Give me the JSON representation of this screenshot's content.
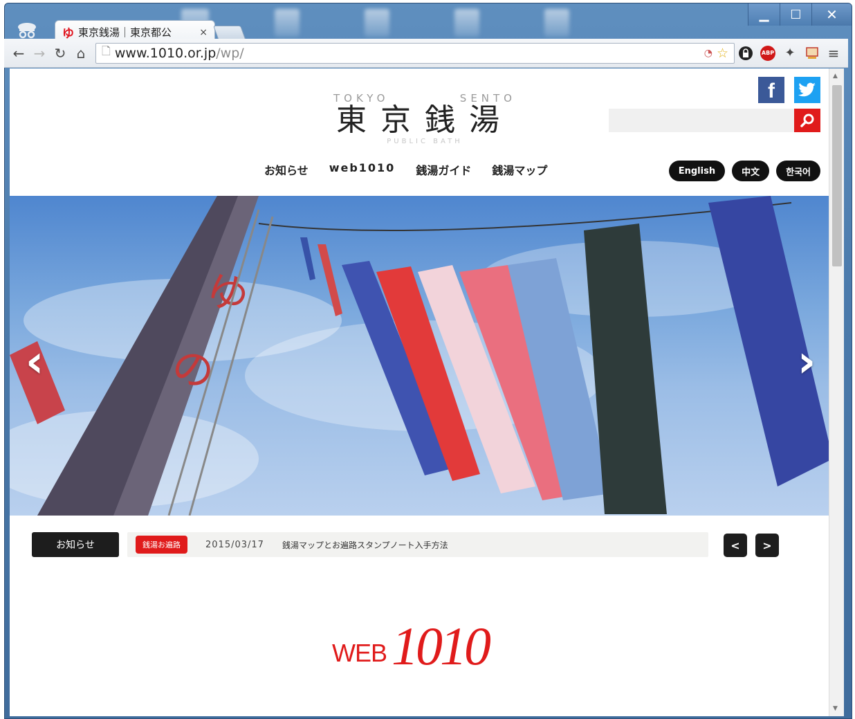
{
  "browser": {
    "tab_title": "東京銭湯｜東京都公",
    "tab_close": "×",
    "url_host": "www.1010.or.jp",
    "url_path": "/wp/",
    "controls": {
      "minimize": "▁",
      "maximize": "☐",
      "close": "✕"
    }
  },
  "header": {
    "logo_roman_left": "TOKYO",
    "logo_roman_right": "SENTO",
    "logo_kanji": "東京銭湯",
    "logo_subtitle": "PUBLIC BATH",
    "social": {
      "facebook": "f"
    }
  },
  "search": {
    "value": "",
    "placeholder": ""
  },
  "nav": {
    "items": [
      "お知らせ",
      "web1010",
      "銭湯ガイド",
      "銭湯マップ"
    ]
  },
  "languages": [
    "English",
    "中文",
    "한국어"
  ],
  "news": {
    "label": "お知らせ",
    "tag": "銭湯お遍路",
    "date": "2015/03/17",
    "title": "銭湯マップとお遍路スタンプノート入手方法",
    "prev": "<",
    "next": ">"
  },
  "web_logo": {
    "word": "WEB",
    "number": "1010"
  }
}
